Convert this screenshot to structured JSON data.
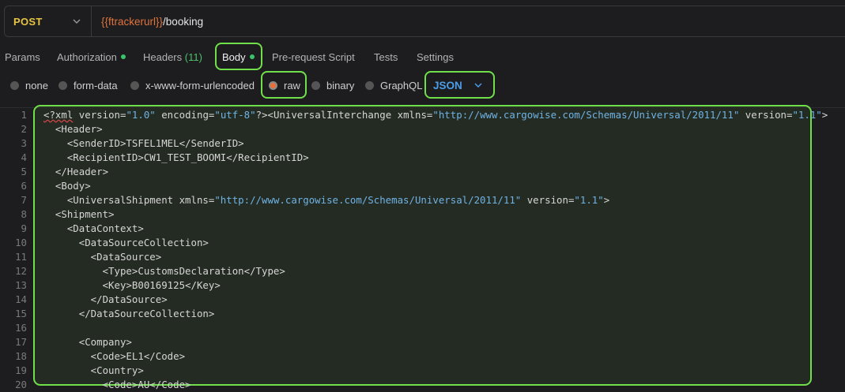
{
  "request": {
    "method": "POST",
    "url_var": "{{ftrackerurl}}",
    "url_path": "/booking"
  },
  "tabs": [
    {
      "label": "Params"
    },
    {
      "label": "Authorization",
      "dot": true
    },
    {
      "label": "Headers",
      "count": "(11)"
    },
    {
      "label": "Body",
      "dot": true,
      "active": true
    },
    {
      "label": "Pre-request Script"
    },
    {
      "label": "Tests"
    },
    {
      "label": "Settings"
    }
  ],
  "body_types": [
    "none",
    "form-data",
    "x-www-form-urlencoded",
    "raw",
    "binary",
    "GraphQL"
  ],
  "selected_type": "raw",
  "format_dropdown": "JSON",
  "editor": {
    "line_numbers": [
      "1",
      "2",
      "3",
      "4",
      "5",
      "6",
      "7",
      "8",
      "9",
      "10",
      "11",
      "12",
      "13",
      "14",
      "15",
      "16",
      "17",
      "18",
      "19",
      "20"
    ],
    "lines": [
      "<?xml version=\"1.0\" encoding=\"utf-8\"?><UniversalInterchange xmlns=\"http://www.cargowise.com/Schemas/Universal/2011/11\" version=\"1.1\">",
      "  <Header>",
      "    <SenderID>TSFEL1MEL</SenderID>",
      "    <RecipientID>CW1_TEST_BOOMI</RecipientID>",
      "  </Header>",
      "  <Body>",
      "    <UniversalShipment xmlns=\"http://www.cargowise.com/Schemas/Universal/2011/11\" version=\"1.1\">",
      "  <Shipment>",
      "    <DataContext>",
      "      <DataSourceCollection>",
      "        <DataSource>",
      "          <Type>CustomsDeclaration</Type>",
      "          <Key>B00169125</Key>",
      "        </DataSource>",
      "      </DataSourceCollection>",
      "",
      "      <Company>",
      "        <Code>EL1</Code>",
      "        <Country>",
      "          <Code>AU</Code>"
    ]
  },
  "colors": {
    "highlight": "#6fe04a",
    "method": "#e8c443",
    "url_variable": "#e0733d",
    "status_dot": "#39c46b",
    "dropdown": "#4a9eea"
  }
}
